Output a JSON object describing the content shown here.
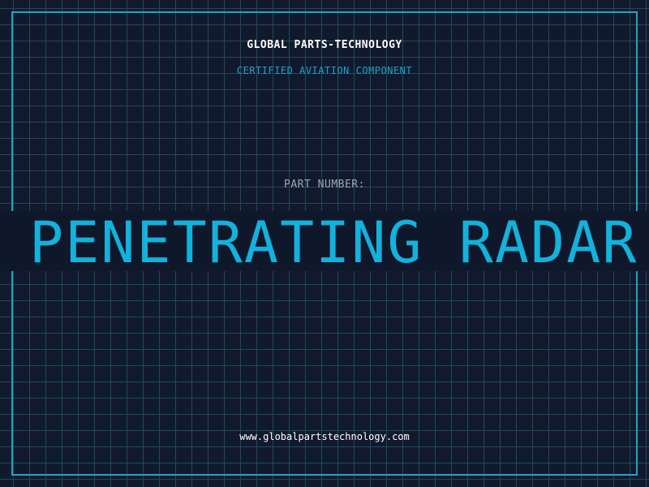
{
  "header": {
    "company": "GLOBAL PARTS-TECHNOLOGY",
    "tagline": "CERTIFIED AVIATION COMPONENT"
  },
  "part": {
    "label": "PART NUMBER:",
    "name": "PENETRATING RADAR"
  },
  "footer": {
    "website": "www.globalpartstechnology.com"
  },
  "colors": {
    "background": "#111a2d",
    "grid": "#1f4a5a",
    "accent": "#1fa3c9",
    "part_text": "#12b2dc",
    "label": "#9aa8b8"
  }
}
